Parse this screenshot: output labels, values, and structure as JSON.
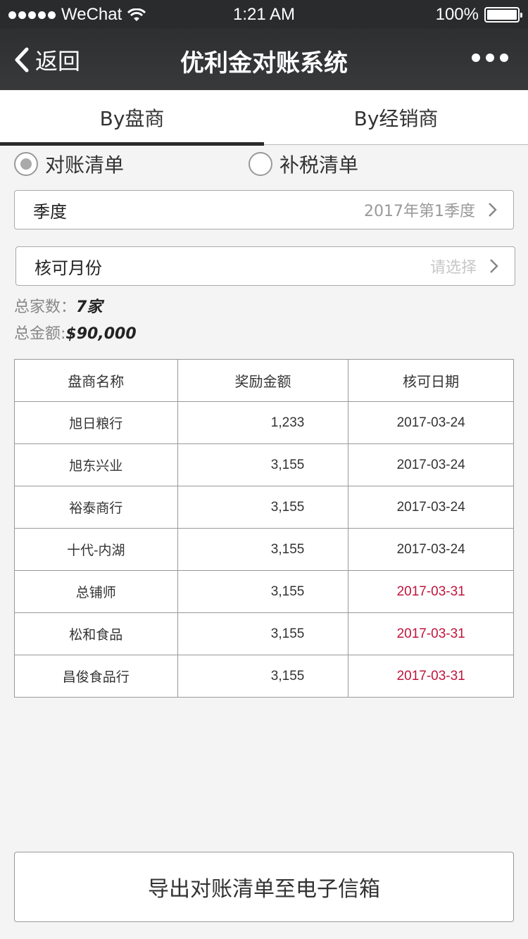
{
  "status": {
    "carrier": "WeChat",
    "time": "1:21 AM",
    "battery": "100%",
    "battery_level": 1.0
  },
  "nav": {
    "back_label": "返回",
    "title": "优利金对账系统"
  },
  "tabs": [
    {
      "label": "By盘商",
      "active": true
    },
    {
      "label": "By经销商",
      "active": false
    }
  ],
  "radios": [
    {
      "label": "对账清单",
      "selected": true
    },
    {
      "label": "补税清单",
      "selected": false
    }
  ],
  "fields": {
    "quarter": {
      "label": "季度",
      "value": "2017年第1季度"
    },
    "month": {
      "label": "核可月份",
      "placeholder": "请选择"
    }
  },
  "summary": {
    "count_label": "总家数：",
    "count_value": "7家",
    "amount_label": "总金额:",
    "amount_value": "$90,000"
  },
  "table": {
    "headers": [
      "盘商名称",
      "奖励金额",
      "核可日期"
    ],
    "rows": [
      {
        "name": "旭日粮行",
        "amount": "1,233",
        "date": "2017-03-24"
      },
      {
        "name": "旭东兴业",
        "amount": "3,155",
        "date": "2017-03-24"
      },
      {
        "name": "裕泰商行",
        "amount": "3,155",
        "date": "2017-03-24"
      },
      {
        "name": "十代-内湖",
        "amount": "3,155",
        "date": "2017-03-24"
      },
      {
        "name": "总铺师",
        "amount": "3,155",
        "date": "2017-03-31"
      },
      {
        "name": "松和食品",
        "amount": "3,155",
        "date": "2017-03-31"
      },
      {
        "name": "昌俊食品行",
        "amount": "3,155",
        "date": "2017-03-31"
      }
    ]
  },
  "export_button": "导出对账清单至电子信箱",
  "colors": {
    "nav_bg": "#2e2f31",
    "highlight_date": "#c0143c",
    "background": "#f4f4f4"
  }
}
